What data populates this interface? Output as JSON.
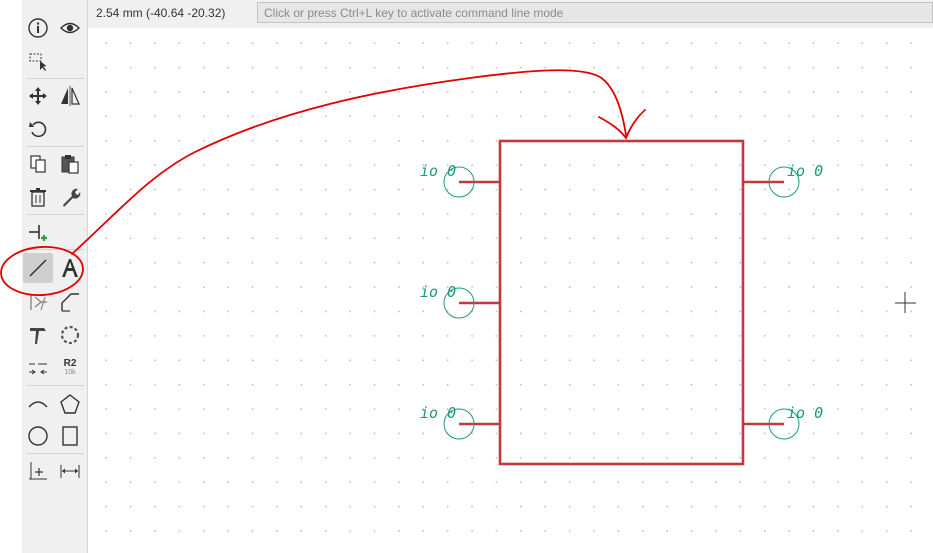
{
  "status": {
    "grid_and_cursor": "2.54 mm (-40.64 -20.32)",
    "command_placeholder": "Click or press Ctrl+L key to activate command line mode"
  },
  "toolbar": {
    "tools": [
      {
        "name": "info-icon"
      },
      {
        "name": "eye-icon"
      },
      {
        "name": "select-area-icon"
      },
      {
        "name": "move-icon"
      },
      {
        "name": "mirror-icon"
      },
      {
        "name": "rotate-icon"
      },
      {
        "name": "copy-icon"
      },
      {
        "name": "paste-icon"
      },
      {
        "name": "delete-icon"
      },
      {
        "name": "wrench-icon"
      },
      {
        "name": "add-pin-icon"
      },
      {
        "name": "line-icon",
        "active": true
      },
      {
        "name": "text-icon"
      },
      {
        "name": "pin-line-icon"
      },
      {
        "name": "anchor-icon"
      },
      {
        "name": "hammer-icon"
      },
      {
        "name": "dashed-circle-icon"
      },
      {
        "name": "align-icon"
      },
      {
        "name": "reference-icon"
      },
      {
        "name": "arc-icon"
      },
      {
        "name": "polygon-icon"
      },
      {
        "name": "circle-icon"
      },
      {
        "name": "rectangle-icon"
      },
      {
        "name": "origin-icon"
      },
      {
        "name": "measure-icon"
      }
    ],
    "reference_label": "R2",
    "reference_value": "10k"
  },
  "schematic": {
    "pins": [
      {
        "label": "io 0",
        "side": "left",
        "row": 1
      },
      {
        "label": "io 0",
        "side": "left",
        "row": 2
      },
      {
        "label": "io 0",
        "side": "left",
        "row": 3
      },
      {
        "label": "io 0",
        "side": "right",
        "row": 1
      },
      {
        "label": "io 0",
        "side": "right",
        "row": 3
      }
    ],
    "body_color": "#c0393b",
    "pin_text_color": "#1c9a7c",
    "annotation_color": "#e00000"
  }
}
